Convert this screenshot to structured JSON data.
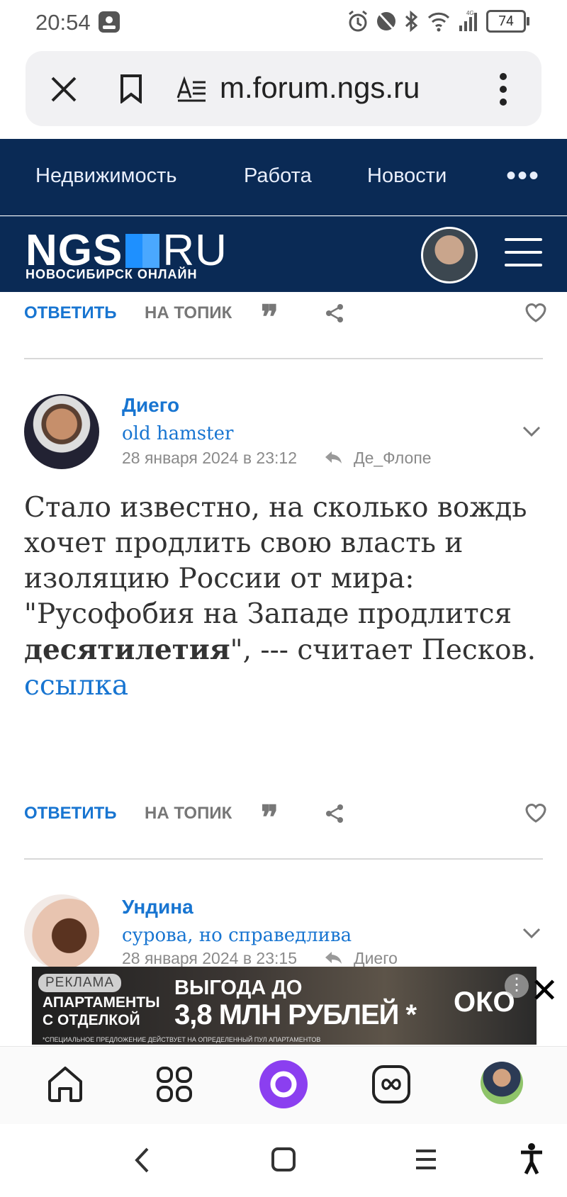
{
  "status_bar": {
    "time": "20:54",
    "battery": "74",
    "network": "4G"
  },
  "url_bar": {
    "url": "m.forum.ngs.ru"
  },
  "top_nav": {
    "items": [
      "Недвижимость",
      "Работа",
      "Новости"
    ]
  },
  "brand": {
    "logo_main": "NGS",
    "logo_suffix": "RU",
    "logo_sub": "НОВОСИБИРСК ОНЛАЙН"
  },
  "actions": {
    "reply": "ОТВЕТИТЬ",
    "to_topic": "НА ТОПИК"
  },
  "posts": [
    {
      "author": "Диего",
      "rank": "old hamster",
      "date": "28 января 2024 в 23:12",
      "reply_to": "Де_Флопе",
      "text_1": "Стало известно, на сколько вождь хочет продлить свою власть и изоляцию России от мира:",
      "text_2": "\"Русофобия на Западе продлится ",
      "text_bold": "десятилетия",
      "text_3": "\", --- считает Песков.",
      "link": "ссылка"
    },
    {
      "author": "Ундина",
      "rank": "сурова, но справедлива",
      "date": "28 января 2024 в 23:15",
      "reply_to": "Диего"
    }
  ],
  "ad": {
    "label": "РЕКЛАМА",
    "left_line1": "АПАРТАМЕНТЫ",
    "left_line2": "С ОТДЕЛКОЙ",
    "headline1": "ВЫГОДА ДО",
    "headline2": "3,8 МЛН РУБЛЕЙ *",
    "fine_print": "*СПЕЦИАЛЬНОЕ ПРЕДЛОЖЕНИЕ ДЕЙСТВУЕТ НА ОПРЕДЕЛЕННЫЙ ПУЛ АПАРТАМЕНТОВ",
    "brand": "ОКО"
  },
  "colors": {
    "nav_bg": "#0a2a55",
    "link": "#1875d1",
    "alice": "#8b3ff0"
  }
}
